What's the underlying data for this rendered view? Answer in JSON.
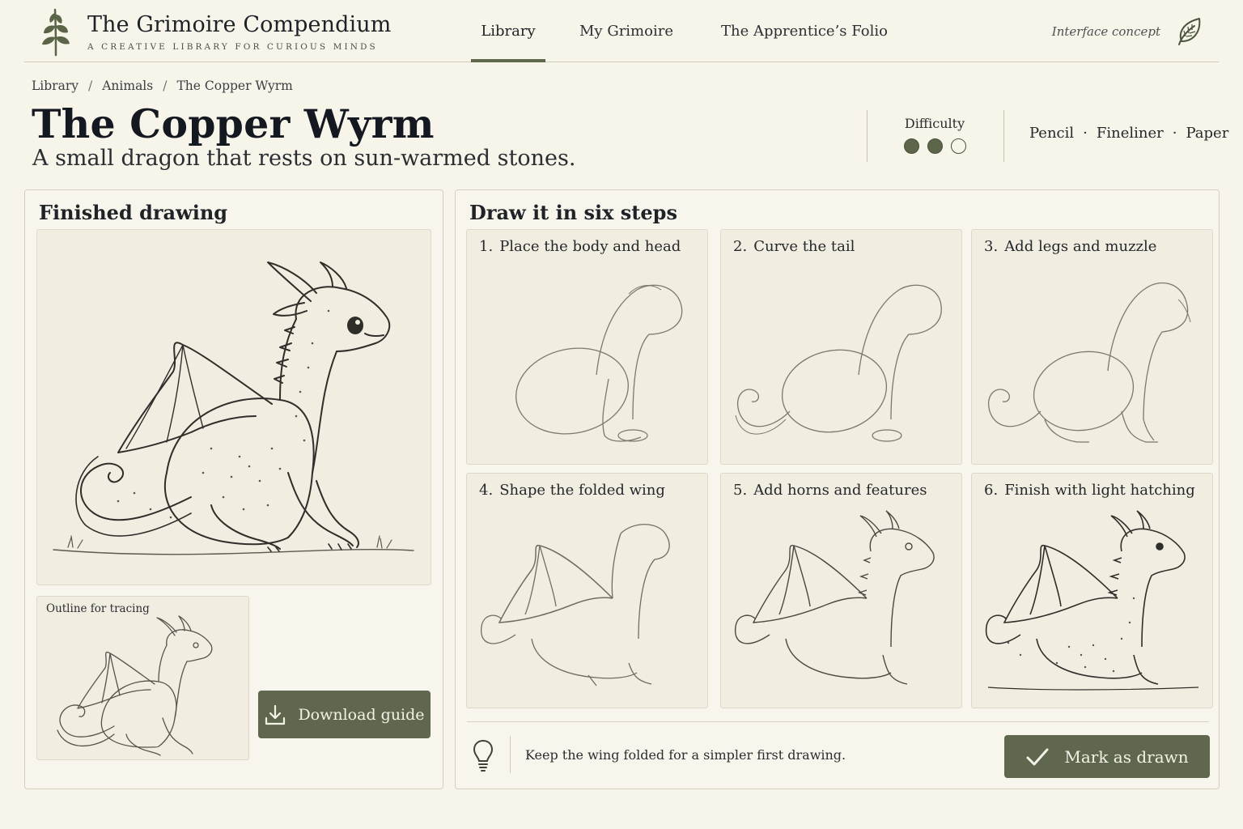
{
  "app": {
    "title": "The Grimoire Compendium",
    "tagline": "A CREATIVE LIBRARY FOR CURIOUS MINDS",
    "logo_icon": "sprig-icon"
  },
  "nav": {
    "items": [
      {
        "label": "Library",
        "active": true
      },
      {
        "label": "My Grimoire",
        "active": false
      },
      {
        "label": "The Apprentice’s Folio",
        "active": false
      }
    ],
    "concept_label": "Interface concept",
    "concept_icon": "leaf-icon"
  },
  "breadcrumb": [
    "Library",
    "Animals",
    "The Copper Wyrm"
  ],
  "breadcrumb_separator": "/",
  "page": {
    "title": "The Copper Wyrm",
    "subtitle": "A small dragon that rests on sun-warmed stones."
  },
  "difficulty": {
    "label": "Difficulty",
    "level": 2,
    "max": 3
  },
  "materials": [
    "Pencil",
    "Fineliner",
    "Paper"
  ],
  "materials_separator": "·",
  "finished": {
    "heading": "Finished drawing",
    "trace_label": "Outline for tracing",
    "download_label": "Download guide",
    "download_icon": "download-icon"
  },
  "steps": {
    "heading": "Draw it in six steps",
    "items": [
      {
        "num": "1.",
        "label": "Place the body and head"
      },
      {
        "num": "2.",
        "label": "Curve the tail"
      },
      {
        "num": "3.",
        "label": "Add legs and muzzle"
      },
      {
        "num": "4.",
        "label": "Shape the folded wing"
      },
      {
        "num": "5.",
        "label": "Add horns and features"
      },
      {
        "num": "6.",
        "label": "Finish with light hatching"
      }
    ]
  },
  "tip": {
    "icon": "lightbulb-icon",
    "text": "Keep the wing folded for a simpler first drawing."
  },
  "actions": {
    "mark_label": "Mark as drawn",
    "mark_icon": "checkmark-icon"
  },
  "colors": {
    "background": "#f7f5ea",
    "accent": "#5f684e",
    "panel_border": "#d3cfbf",
    "text": "#1d2024"
  }
}
